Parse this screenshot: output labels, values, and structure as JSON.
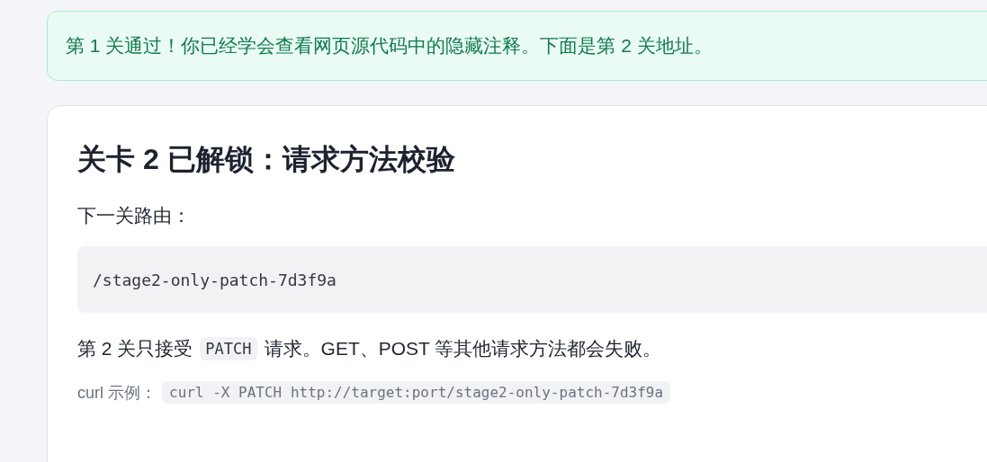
{
  "notice": {
    "text": "第 1 关通过！你已经学会查看网页源代码中的隐藏注释。下面是第 2 关地址。"
  },
  "card": {
    "title": "关卡 2 已解锁：请求方法校验",
    "route_label": "下一关路由：",
    "route": "/stage2-only-patch-7d3f9a",
    "method_note": {
      "before": "第 2 关只接受",
      "code": "PATCH",
      "after": "请求。GET、POST 等其他请求方法都会失败。"
    },
    "curl": {
      "label": "curl 示例：",
      "code": "curl -X PATCH http://target:port/stage2-only-patch-7d3f9a"
    }
  }
}
